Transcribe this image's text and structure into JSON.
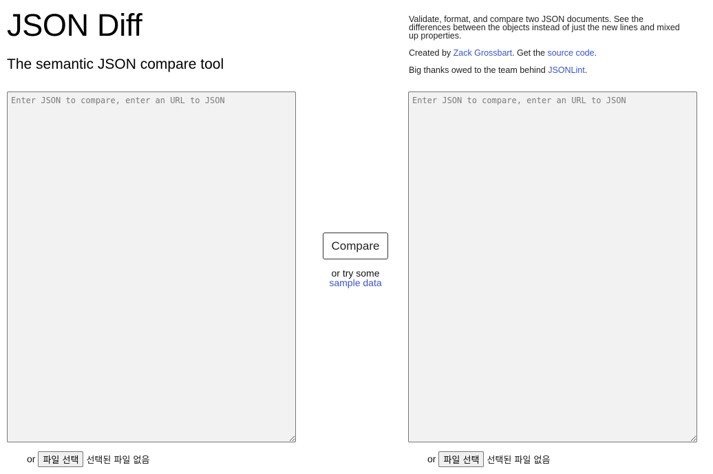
{
  "header": {
    "title": "JSON Diff",
    "subtitle": "The semantic JSON compare tool"
  },
  "about": {
    "description": "Validate, format, and compare two JSON documents. See the differences between the objects instead of just the new lines and mixed up properties.",
    "created_by_prefix": "Created by ",
    "author_link": "Zack Grossbart",
    "get_the_text": ". Get the ",
    "source_code_link": "source code",
    "period": ".",
    "thanks_prefix": "Big thanks owed to the team behind ",
    "jsonlint_link": "JSONLint",
    "thanks_suffix": "."
  },
  "left_editor": {
    "placeholder": "Enter JSON to compare, enter an URL to JSON",
    "value": ""
  },
  "right_editor": {
    "placeholder": "Enter JSON to compare, enter an URL to JSON",
    "value": ""
  },
  "compare": {
    "button_label": "Compare",
    "try_text": "or try some",
    "sample_link": "sample data"
  },
  "file_upload": {
    "or_label": "or",
    "button_label": "파일 선택",
    "status": "선택된 파일 없음"
  },
  "colors": {
    "link": "#3a55c8",
    "textarea_bg": "#f2f2f2"
  }
}
